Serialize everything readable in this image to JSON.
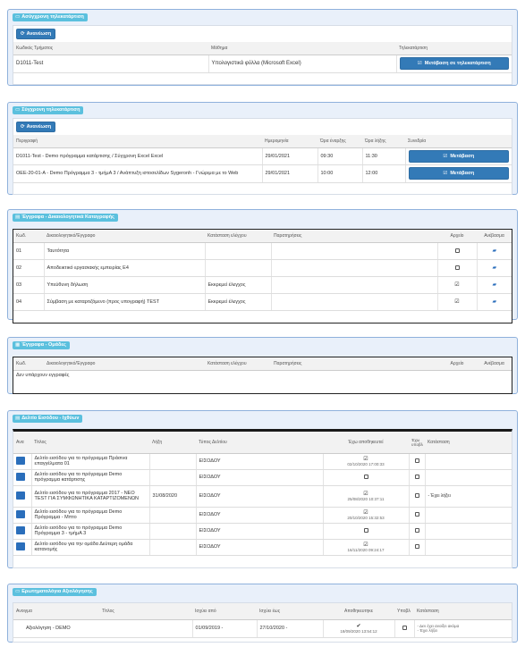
{
  "sync_panel": {
    "title": "Ασύγχρονη τηλεκατάρτιση",
    "refresh_label": "Ανανέωση",
    "headers": [
      "Κωδικός Τμήματος",
      "Μάθημα",
      "Τηλεκατάρτιση"
    ],
    "rows": [
      {
        "code": "D1011-Test",
        "lesson": "Υπολογιστικά φύλλα (Microsoft Excel)",
        "action": "Μετάβαση σε τηλεκατάρτιση"
      }
    ]
  },
  "async_panel": {
    "title": "Σύγχρονη τηλεκατάρτιση",
    "refresh_label": "Ανανέωση",
    "headers": [
      "Περιγραφή",
      "Ημερομηνία",
      "Ώρα έναρξης",
      "Ώρα λήξης",
      "Συνεδρία"
    ],
    "rows": [
      {
        "desc": "D1011-Test - Demo πρόγραμμα κατάρτισης / Σύγχρονη Excel Excel",
        "date": "29/01/2021",
        "start": "09:30",
        "end": "11:30",
        "action": "Μετάβαση"
      },
      {
        "desc": "OEE-20-01-A - Demo Πρόγραμμα 3 - τμήμΑ 3 / Ανάπτυξη ιστοσελίδων Sygeronh - Γνώριμα με το Web",
        "date": "29/01/2021",
        "start": "10:00",
        "end": "12:00",
        "action": "Μετάβαση"
      }
    ]
  },
  "docs_panel": {
    "title": "Έγγραφα - Δικαιολογητικά Καταγραφής",
    "headers": [
      "Κωδ.",
      "Δικαιολογητικό/Έγγραφο",
      "Κατάσταση ελέγχου",
      "Παρατηρήσεις",
      "Αρχείο",
      "Ανέβασμα"
    ],
    "rows": [
      {
        "code": "01",
        "doc": "Ταυτότητα",
        "status": "",
        "checked": false
      },
      {
        "code": "02",
        "doc": "Αποδεικτικό εργασιακής εμπειρίας Ε4",
        "status": "",
        "checked": false
      },
      {
        "code": "03",
        "doc": "Υπεύθυνη δήλωση",
        "status": "Εκκρεμεί έλεγχος",
        "checked": true
      },
      {
        "code": "04",
        "doc": "Σύμβαση με καταρτιζόμενο (προς υπογραφή) TEST",
        "status": "Εκκρεμεί έλεγχος",
        "checked": true
      }
    ]
  },
  "groups_panel": {
    "title": "Έγγραφα - Ομάδες",
    "headers": [
      "Κωδ.",
      "Δικαιολογητικό/Έγγραφο",
      "Κατάσταση ελέγχου",
      "Παρατηρήσεις",
      "Αρχείο",
      "Ανέβασμα"
    ],
    "empty_text": "Δεν υπάρχουν εγγραφές"
  },
  "forms_panel": {
    "title": "Δελτίο Εισόδου - Ιχθύων",
    "headers": [
      "Ανα",
      "Τίτλος",
      "Λήξη",
      "Τύπος Δελτίου",
      "Έχω αποθηκευτεί",
      "Έχω υποβλ",
      "Κατάσταση"
    ],
    "rows": [
      {
        "title": "Δελτίο εισόδου για το πρόγραμμα Πράσινα επαγγέλματα 01",
        "deadline": "",
        "type": "ΕΙΣΟΔΟΥ",
        "saved": true,
        "saved_at": "02/10/2020 17:00:33",
        "status": ""
      },
      {
        "title": "Δελτίο εισόδου για το πρόγραμμα Demo πρόγραμμα κατάρτισης",
        "deadline": "",
        "type": "ΕΙΣΟΔΟΥ",
        "saved": false,
        "saved_at": "",
        "status": ""
      },
      {
        "title": "Δελτίο εισόδου για το πρόγραμμα 2017 - ΝΕΟ TEST ΓΙΑ ΣΥΜΦΩΝΗΤΙΚΑ ΚΑΤΑΡΤΙΖΟΜΕΝΩΝ",
        "deadline": "31/08/2020",
        "type": "ΕΙΣΟΔΟΥ",
        "saved": true,
        "saved_at": "25/08/2020 10:37:11",
        "status": "- Έχει λήξει"
      },
      {
        "title": "Δελτίο εισόδου για το πρόγραμμα Demo Πρόγραμμα - Μπτο",
        "deadline": "",
        "type": "ΕΙΣΟΔΟΥ",
        "saved": true,
        "saved_at": "20/10/2020 15:32:53",
        "status": ""
      },
      {
        "title": "Δελτίο εισόδου για το πρόγραμμα Demo Πρόγραμμα 3 - τμήμΑ 3",
        "deadline": "",
        "type": "ΕΙΣΟΔΟΥ",
        "saved": false,
        "saved_at": "",
        "status": ""
      },
      {
        "title": "Δελτίο εισόδου για την ομάδα Δεύτερη ομάδα κατανομής",
        "deadline": "",
        "type": "ΕΙΣΟΔΟΥ",
        "saved": true,
        "saved_at": "16/11/2020 09:24:17",
        "status": ""
      }
    ]
  },
  "eval_panel": {
    "title": "Ερωτηματολόγια Αξιολόγησης",
    "headers": [
      "Ανοιγμα",
      "Τίτλος",
      "Ισχύει από",
      "Ισχύει έως",
      "Αποθηκευτηκε",
      "Υποβλ",
      "Κατάσταση"
    ],
    "rows": [
      {
        "title": "Αξιολόγηση - DEMO",
        "from": "01/09/2019 -",
        "to": "27/10/2020 -",
        "saved_at": "18/09/2020 13:54:12",
        "status1": "- Δεν έχει ανοίξει ακόμα",
        "status2": "- Έχει λήξει"
      }
    ]
  }
}
